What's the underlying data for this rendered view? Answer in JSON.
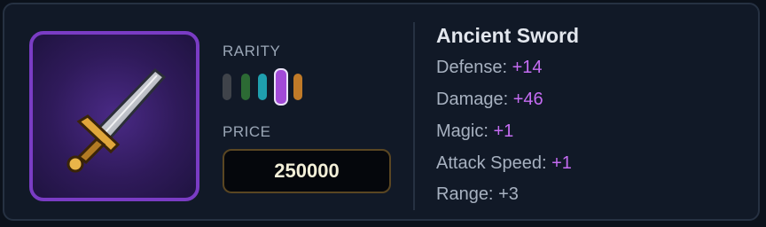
{
  "item": {
    "name": "Ancient Sword",
    "icon": "sword-icon"
  },
  "rarity": {
    "label": "RARITY",
    "levels": [
      {
        "tier": "common",
        "color": "#3f434a",
        "selected": false
      },
      {
        "tier": "uncommon",
        "color": "#2c6a34",
        "selected": false
      },
      {
        "tier": "rare",
        "color": "#1f9fae",
        "selected": false
      },
      {
        "tier": "epic",
        "color": "#a24ad7",
        "selected": true
      },
      {
        "tier": "legendary",
        "color": "#c07a28",
        "selected": false
      }
    ]
  },
  "price": {
    "label": "PRICE",
    "value": "250000"
  },
  "stats": [
    {
      "label": "Defense:",
      "value": "+14",
      "highlight": true
    },
    {
      "label": "Damage:",
      "value": "+46",
      "highlight": true
    },
    {
      "label": "Magic:",
      "value": "+1",
      "highlight": true
    },
    {
      "label": "Attack Speed:",
      "value": "+1",
      "highlight": true
    },
    {
      "label": "Range:",
      "value": "+3",
      "highlight": false
    }
  ],
  "colors": {
    "frame_border": "#7a3cc4",
    "stat_bonus": "#c56cf2",
    "price_border": "#5a4622"
  }
}
